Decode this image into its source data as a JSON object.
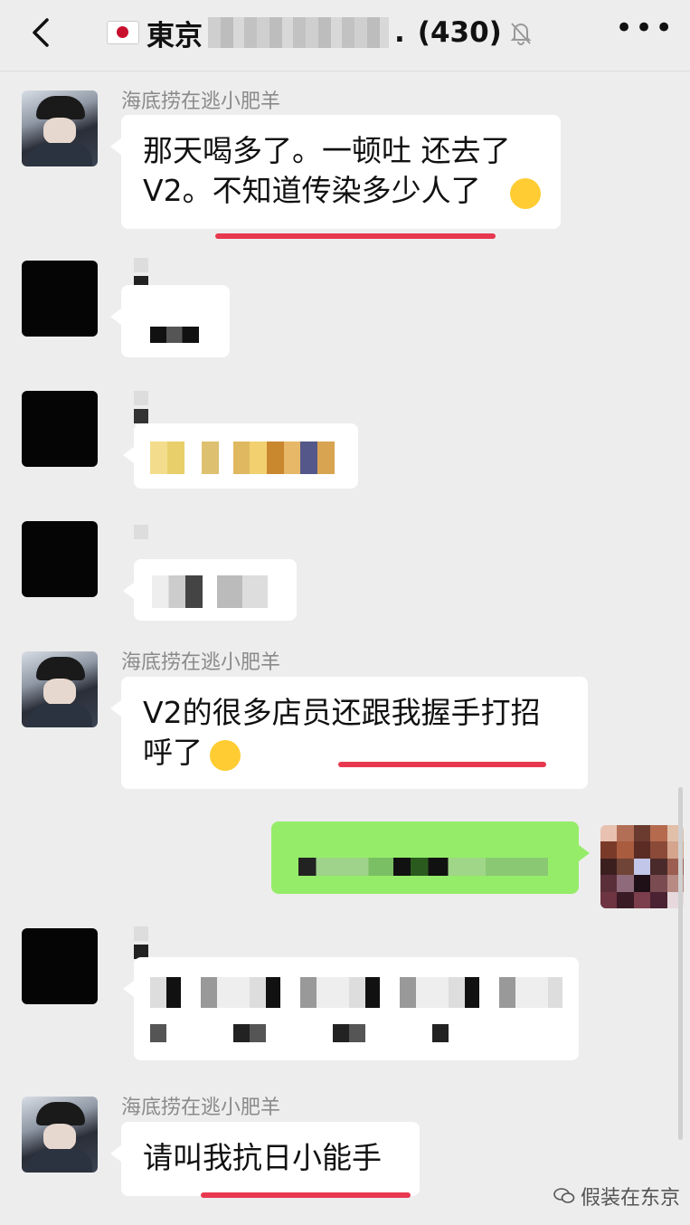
{
  "header": {
    "title_prefix": "東京",
    "title_suffix": ".",
    "member_count": "(430)",
    "back_icon": "chevron-left-icon",
    "mute_icon": "bell-off-icon",
    "more_icon": "more-dots-icon",
    "more_label": "•••"
  },
  "messages": [
    {
      "sender": "海底捞在逃小肥羊",
      "text_line1": "那天喝多了。一顿吐 还去了",
      "text_line2": "V2。不知道传染多少人了"
    },
    {
      "sender": "海底捞在逃小肥羊",
      "text_line1": "V2的很多店员还跟我握手打招",
      "text_line2": "呼了"
    },
    {
      "sender": "海底捞在逃小肥羊",
      "text_line1": "请叫我抗日小能手"
    }
  ],
  "watermark": {
    "label": "假装在东京"
  },
  "colors": {
    "background": "#ededed",
    "bubble_self": "#95ec69",
    "underline": "#e8384f"
  }
}
